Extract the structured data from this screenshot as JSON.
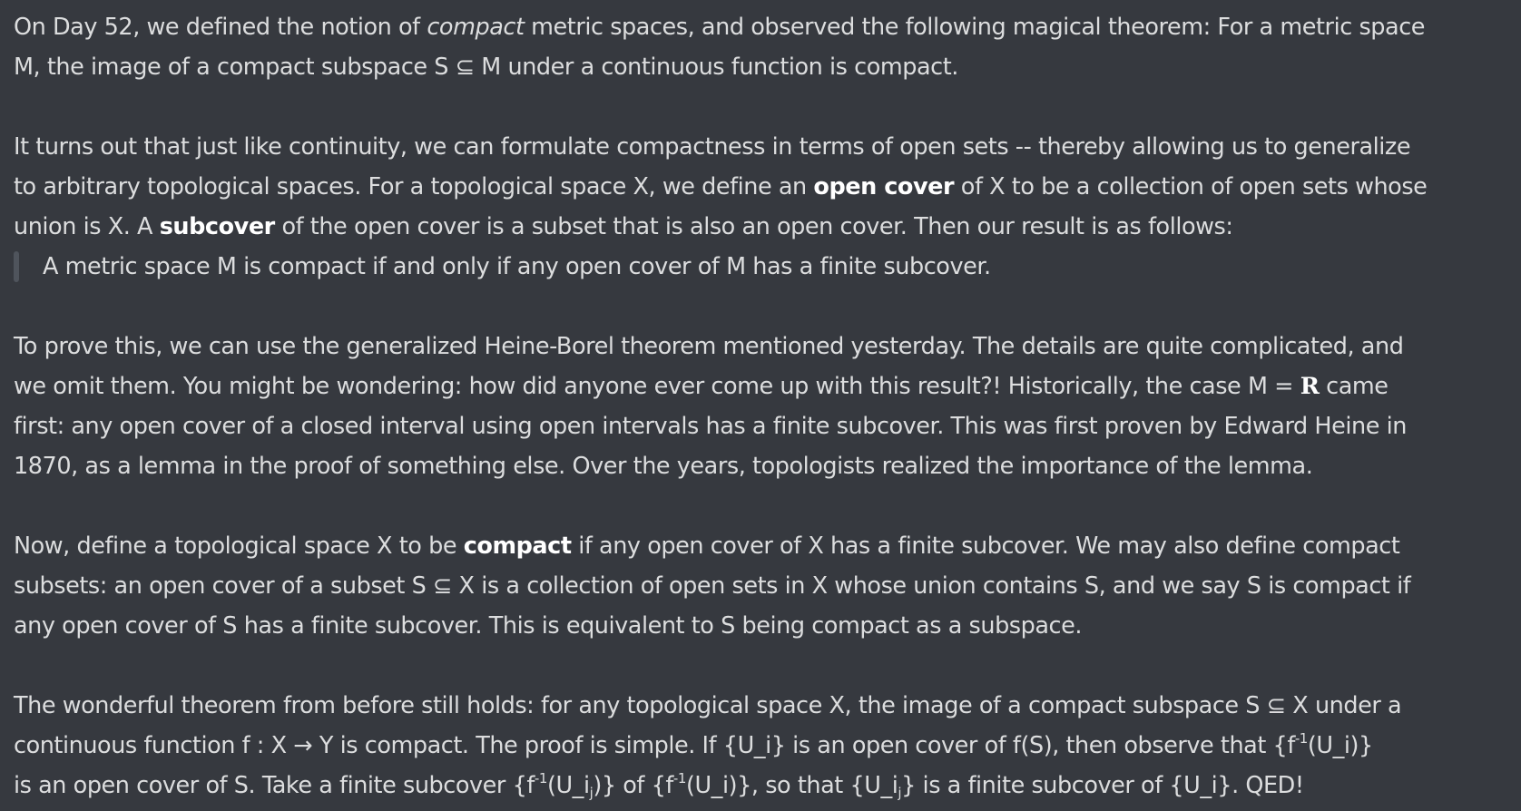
{
  "message": {
    "p1": {
      "l1_a": "On Day 52, we defined the notion of ",
      "l1_em": "compact",
      "l1_b": " metric spaces, and observed the following magical theorem: For a metric space",
      "l2": "M, the image of a compact subspace S ⊆ M under a continuous function is compact."
    },
    "p2": {
      "l1": "It turns out that just like continuity, we can formulate compactness in terms of open sets -- thereby allowing us to generalize",
      "l2_a": "to arbitrary topological spaces. For a topological space X, we define an ",
      "l2_bold": "open cover",
      "l2_b": " of X to be a collection of open sets whose",
      "l3_a": "union is X. A ",
      "l3_bold": "subcover",
      "l3_b": " of the open cover is a subset that is also an open cover. Then our result is as follows:"
    },
    "quote": "A metric space M is compact if and only if any open cover of M has a finite subcover.",
    "p3": {
      "l1": "To prove this, we can use the generalized Heine-Borel theorem mentioned yesterday. The details are quite complicated, and",
      "l2_a": "we omit them. You might be wondering: how did anyone ever come up with this result?! Historically, the case M = ",
      "l2_R": "R",
      "l2_b": " came",
      "l3": "first: any open cover of a closed interval using open intervals has a finite subcover. This was first proven by Edward Heine in",
      "l4": "1870, as a lemma in the proof of something else. Over the years, topologists realized the importance of the lemma."
    },
    "p4": {
      "l1_a": "Now, define a topological space X to be ",
      "l1_bold": "compact",
      "l1_b": " if any open cover of X has a finite subcover. We may also define compact",
      "l2": "subsets: an open cover of a subset S ⊆ X is a collection of open sets in X whose union contains S, and we say S is compact if",
      "l3": "any open cover of S has a finite subcover. This is equivalent to S being compact as a subspace."
    },
    "p5": {
      "l1": "The wonderful theorem from before still holds: for any topological space X, the image of a compact subspace S ⊆ X under a",
      "l2_a": "continuous function f : X → Y is compact. The proof is simple. If {U_i} is an open cover of f(S), then observe that {f",
      "l2_sup": "-1",
      "l2_b": "(U_i)}",
      "l3_a": "is an open cover of S. Take a finite subcover {f",
      "l3_sup1": "-1",
      "l3_b": "(U_i",
      "l3_sub1": "j",
      "l3_c": ")} of {f",
      "l3_sup2": "-1",
      "l3_d": "(U_i)}, so that {U_i",
      "l3_sub2": "j",
      "l3_e": "} is a finite subcover of {U_i}. QED!"
    }
  }
}
